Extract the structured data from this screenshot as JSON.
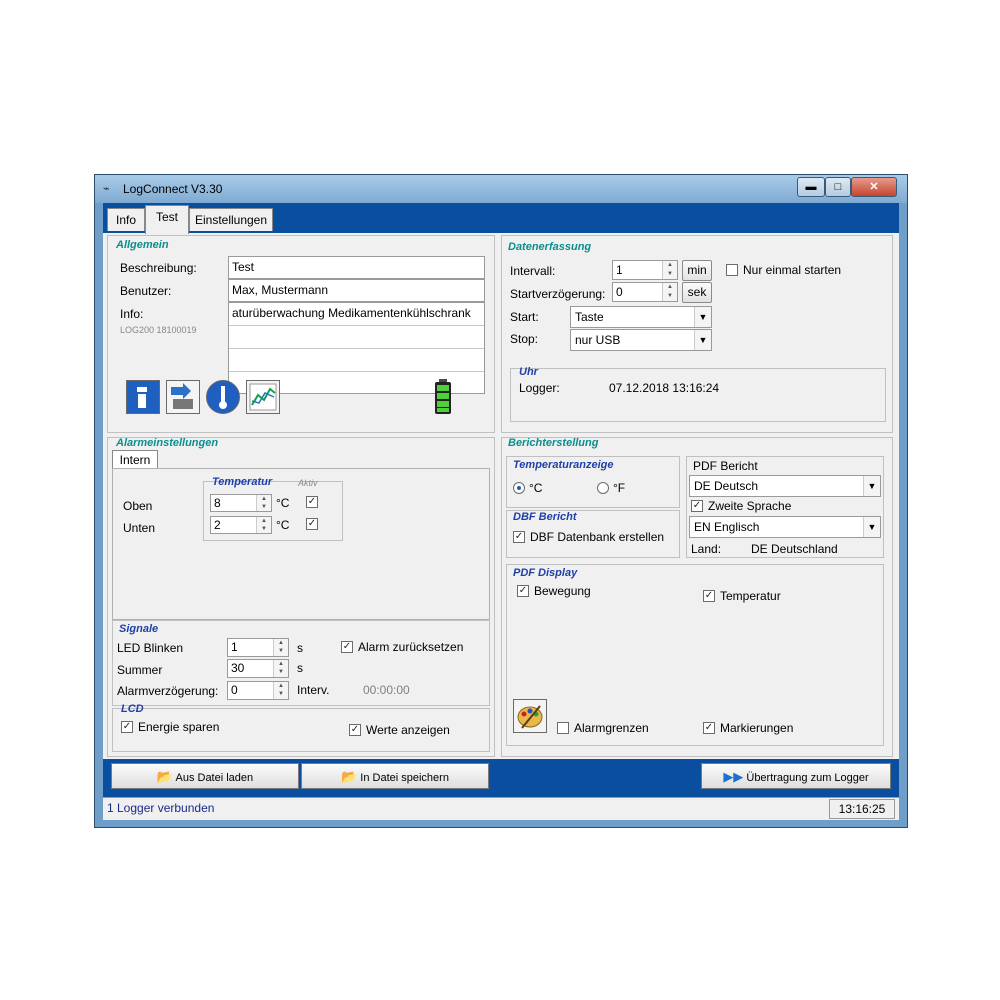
{
  "window": {
    "title": "LogConnect V3.30",
    "btn_min": "▬",
    "btn_max": "□",
    "btn_close": "✕"
  },
  "tabs": [
    "Info",
    "Test",
    "Einstellungen"
  ],
  "allgemein": {
    "title": "Allgemein",
    "beschreibung_label": "Beschreibung:",
    "benutzer_label": "Benutzer:",
    "info_label": "Info:",
    "device_id": "LOG200 18100019",
    "beschreibung_value": "Test",
    "benutzer_value": "Max, Mustermann",
    "info_value": "aturüberwachung Medikamentenkühlschrank"
  },
  "datenerfassung": {
    "title": "Datenerfassung",
    "intervall_label": "Intervall:",
    "intervall_value": "1",
    "intervall_unit": "min",
    "start_delay_label": "Startverzögerung:",
    "start_delay_value": "0",
    "start_delay_unit": "sek",
    "nur_einmal": "Nur einmal starten",
    "start_label": "Start:",
    "start_value": "Taste",
    "stop_label": "Stop:",
    "stop_value": "nur USB"
  },
  "uhr": {
    "title": "Uhr",
    "logger_label": "Logger:",
    "logger_value": "07.12.2018 13:16:24"
  },
  "alarm": {
    "title": "Alarmeinstellungen",
    "tab": "Intern",
    "temp_title": "Temperatur",
    "aktiv": "Aktiv",
    "oben_label": "Oben",
    "oben_value": "8",
    "unten_label": "Unten",
    "unten_value": "2",
    "unit": "°C"
  },
  "signale": {
    "title": "Signale",
    "led_label": "LED Blinken",
    "led_value": "1",
    "led_unit": "s",
    "summer_label": "Summer",
    "summer_value": "30",
    "summer_unit": "s",
    "delay_label": "Alarmverzögerung:",
    "delay_value": "0",
    "delay_unit": "Interv.",
    "delay_time": "00:00:00",
    "alarm_reset": "Alarm zurücksetzen"
  },
  "lcd": {
    "title": "LCD",
    "energie": "Energie sparen",
    "werte": "Werte anzeigen"
  },
  "bericht": {
    "title": "Berichterstellung",
    "temp_display_title": "Temperaturanzeige",
    "celsius": "°C",
    "fahrenheit": "°F",
    "dbf_title": "DBF Bericht",
    "dbf_create": "DBF Datenbank erstellen",
    "pdf_bericht_label": "PDF Bericht",
    "pdf_lang": "DE Deutsch",
    "zweite_sprache": "Zweite Sprache",
    "second_lang": "EN Englisch",
    "land_label": "Land:",
    "land_value": "DE Deutschland",
    "pdf_display_title": "PDF Display",
    "bewegung": "Bewegung",
    "temperatur": "Temperatur",
    "alarmgrenzen": "Alarmgrenzen",
    "markierungen": "Markierungen"
  },
  "bottom": {
    "load": "Aus Datei laden",
    "save": "In Datei speichern",
    "transfer": "Übertragung zum Logger"
  },
  "status": {
    "text": "1 Logger verbunden",
    "time": "13:16:25"
  },
  "colors": {
    "frame": "#0a4ea0",
    "group_title": "#0b8e8e",
    "group_title_blue": "#1f3fa8"
  }
}
